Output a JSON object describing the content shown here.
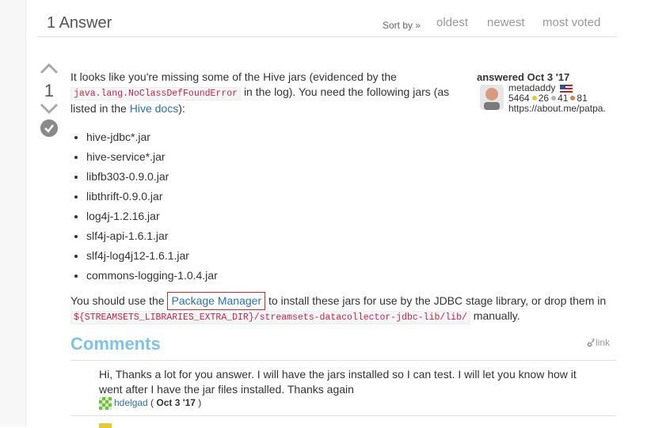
{
  "header": {
    "answers_count": "1 Answer",
    "sort_label": "Sort by »",
    "sort_options": [
      "oldest",
      "newest",
      "most voted"
    ]
  },
  "answer": {
    "votes": "1",
    "p1_a": "It looks like you're missing some of the Hive jars (evidenced by the",
    "p1_code": "java.lang.NoClassDefFoundError",
    "p1_b": "in the log). You need the following jars (as",
    "p1_c": "listed in the",
    "p1_link": "Hive docs",
    "p1_d": "):",
    "jars": [
      "hive-jdbc*.jar",
      "hive-service*.jar",
      "libfb303-0.9.0.jar",
      "libthrift-0.9.0.jar",
      "log4j-1.2.16.jar",
      "slf4j-api-1.6.1.jar",
      "slf4j-log4j12-1.6.1.jar",
      "commons-logging-1.0.4.jar"
    ],
    "p2_a": "You should use the",
    "p2_link": "Package Manager",
    "p2_b": "to install these jars for use by the JDBC stage library, or drop them in",
    "p2_code": "${STREAMSETS_LIBRARIES_EXTRA_DIR}/streamsets-datacollector-jdbc-lib/lib/",
    "p2_c": "manually."
  },
  "user": {
    "answered": "answered Oct 3 '17",
    "name": "metadaddy",
    "reputation": "5464",
    "gold": "26",
    "silver": "41",
    "bronze": "81",
    "website": "https://about.me/patpa."
  },
  "comments": {
    "title": "Comments",
    "link_label": "link",
    "items": [
      {
        "text": "Hi, Thanks a lot for you answer. I will have the jars installed so I can test. I will let you know how it went after I have the jar files installed. Thanks again",
        "author": "hdelgad",
        "date": "Oct 3 '17"
      }
    ]
  },
  "colors": {
    "accent": "#2a6fb5",
    "comments_title": "#7fc2e8",
    "highlight_box": "#c52f2f"
  }
}
